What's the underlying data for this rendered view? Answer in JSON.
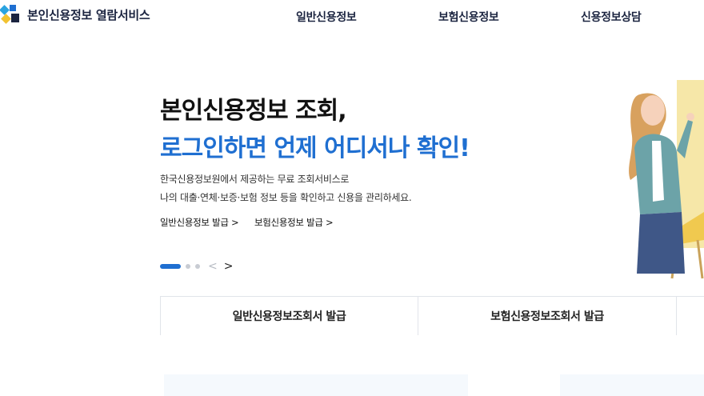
{
  "brand": {
    "title": "본인신용정보 열람서비스",
    "accent": "#1f6fd1",
    "navy": "#1b2440"
  },
  "nav": {
    "items": [
      {
        "label": "일반신용정보"
      },
      {
        "label": "보험신용정보"
      },
      {
        "label": "신용정보상담"
      }
    ]
  },
  "hero": {
    "title_line1": "본인신용정보 조회,",
    "title_line2": "로그인하면 언제 어디서나 확인!",
    "desc_line1": "한국신용정보원에서 제공하는 무료 조회서비스로",
    "desc_line2": "나의 대출·연체·보증·보험 정보 등을 확인하고 신용을 관리하세요.",
    "links": [
      {
        "label": "일반신용정보 발급 >"
      },
      {
        "label": "보험신용정보 발급 >"
      }
    ],
    "slider": {
      "prev": "<",
      "next": ">",
      "current": 1,
      "total": 3
    }
  },
  "quick_tabs": [
    {
      "label": "일반신용정보조회서 발급"
    },
    {
      "label": "보험신용정보조회서 발급"
    }
  ]
}
